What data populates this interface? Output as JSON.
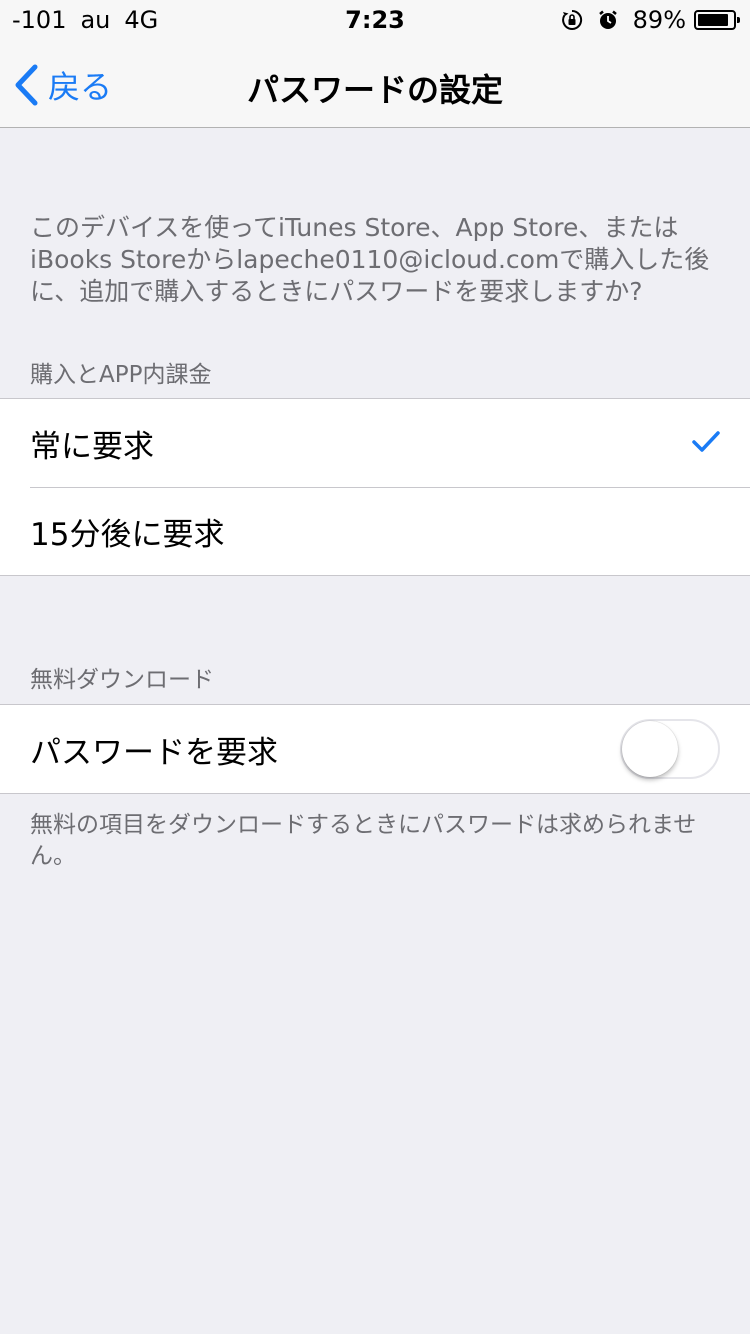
{
  "status_bar": {
    "signal": "-101",
    "carrier": "au",
    "network": "4G",
    "time": "7:23",
    "battery_percent": "89%",
    "battery_level": 0.89,
    "icons": [
      "orientation-lock-icon",
      "alarm-icon",
      "battery-icon"
    ]
  },
  "nav": {
    "back_label": "戻る",
    "title": "パスワードの設定"
  },
  "description": "このデバイスを使ってiTunes Store、App Store、またはiBooks Storeからlapeche0110@icloud.comで購入した後に、追加で購入するときにパスワードを要求しますか?",
  "purchases": {
    "header": "購入とAPP内課金",
    "options": [
      {
        "label": "常に要求",
        "selected": true
      },
      {
        "label": "15分後に要求",
        "selected": false
      }
    ]
  },
  "free_downloads": {
    "header": "無料ダウンロード",
    "toggle_label": "パスワードを要求",
    "toggle_on": false,
    "footer": "無料の項目をダウンロードするときにパスワードは求められません。"
  },
  "colors": {
    "accent": "#1a7bf5",
    "background": "#efeff4",
    "secondary_text": "#6d6d72"
  }
}
